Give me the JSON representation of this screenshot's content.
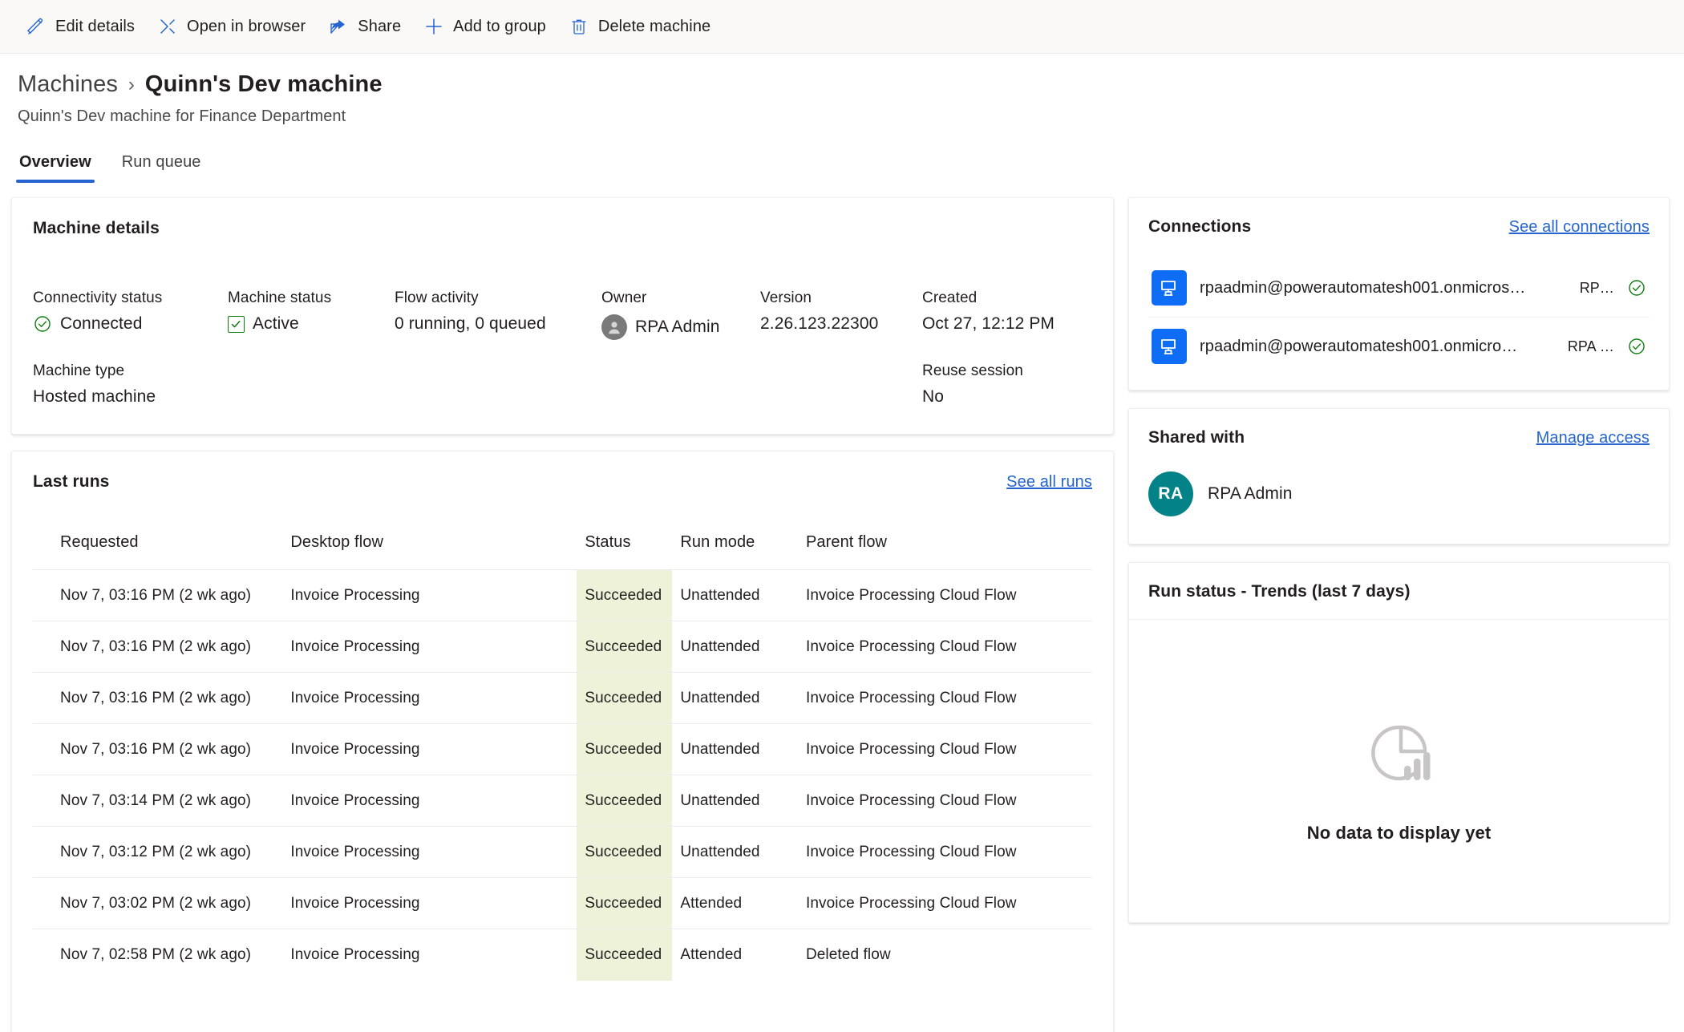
{
  "toolbar": {
    "items": [
      {
        "label": "Edit details",
        "icon": "pencil-icon"
      },
      {
        "label": "Open in browser",
        "icon": "open-in-browser-icon"
      },
      {
        "label": "Share",
        "icon": "share-icon"
      },
      {
        "label": "Add to group",
        "icon": "plus-icon"
      },
      {
        "label": "Delete machine",
        "icon": "trash-icon"
      }
    ]
  },
  "header": {
    "breadcrumb_parent": "Machines",
    "breadcrumb_separator": "›",
    "title": "Quinn's Dev machine",
    "subtitle": "Quinn's Dev machine for Finance Department"
  },
  "tabs": [
    {
      "label": "Overview",
      "active": true
    },
    {
      "label": "Run queue",
      "active": false
    }
  ],
  "machine_details": {
    "title": "Machine details",
    "fields": {
      "connectivity_status_label": "Connectivity status",
      "connectivity_status_value": "Connected",
      "machine_status_label": "Machine status",
      "machine_status_value": "Active",
      "flow_activity_label": "Flow activity",
      "flow_activity_value": "0 running, 0 queued",
      "owner_label": "Owner",
      "owner_value": "RPA Admin",
      "version_label": "Version",
      "version_value": "2.26.123.22300",
      "created_label": "Created",
      "created_value": "Oct 27, 12:12 PM",
      "machine_type_label": "Machine type",
      "machine_type_value": "Hosted machine",
      "reuse_session_label": "Reuse session",
      "reuse_session_value": "No"
    }
  },
  "last_runs": {
    "title": "Last runs",
    "see_all_label": "See all runs",
    "columns": [
      "Requested",
      "Desktop flow",
      "Status",
      "Run mode",
      "Parent flow"
    ],
    "rows": [
      {
        "requested": "Nov 7, 03:16 PM (2 wk ago)",
        "flow": "Invoice Processing",
        "status": "Succeeded",
        "mode": "Unattended",
        "parent": "Invoice Processing Cloud Flow",
        "parent_deleted": false
      },
      {
        "requested": "Nov 7, 03:16 PM (2 wk ago)",
        "flow": "Invoice Processing",
        "status": "Succeeded",
        "mode": "Unattended",
        "parent": "Invoice Processing Cloud Flow",
        "parent_deleted": false
      },
      {
        "requested": "Nov 7, 03:16 PM (2 wk ago)",
        "flow": "Invoice Processing",
        "status": "Succeeded",
        "mode": "Unattended",
        "parent": "Invoice Processing Cloud Flow",
        "parent_deleted": false
      },
      {
        "requested": "Nov 7, 03:16 PM (2 wk ago)",
        "flow": "Invoice Processing",
        "status": "Succeeded",
        "mode": "Unattended",
        "parent": "Invoice Processing Cloud Flow",
        "parent_deleted": false
      },
      {
        "requested": "Nov 7, 03:14 PM (2 wk ago)",
        "flow": "Invoice Processing",
        "status": "Succeeded",
        "mode": "Unattended",
        "parent": "Invoice Processing Cloud Flow",
        "parent_deleted": false
      },
      {
        "requested": "Nov 7, 03:12 PM (2 wk ago)",
        "flow": "Invoice Processing",
        "status": "Succeeded",
        "mode": "Unattended",
        "parent": "Invoice Processing Cloud Flow",
        "parent_deleted": false
      },
      {
        "requested": "Nov 7, 03:02 PM (2 wk ago)",
        "flow": "Invoice Processing",
        "status": "Succeeded",
        "mode": "Attended",
        "parent": "Invoice Processing Cloud Flow",
        "parent_deleted": false
      },
      {
        "requested": "Nov 7, 02:58 PM (2 wk ago)",
        "flow": "Invoice Processing",
        "status": "Succeeded",
        "mode": "Attended",
        "parent": "Deleted flow",
        "parent_deleted": true
      }
    ]
  },
  "connections": {
    "title": "Connections",
    "see_all_label": "See all connections",
    "rows": [
      {
        "name": "rpaadmin@powerautomatesh001.onmicros…",
        "owner": "RP…",
        "status": "connected"
      },
      {
        "name": "rpaadmin@powerautomatesh001.onmicro…",
        "owner": "RPA …",
        "status": "connected"
      }
    ]
  },
  "shared_with": {
    "title": "Shared with",
    "manage_label": "Manage access",
    "people": [
      {
        "initials": "RA",
        "name": "RPA Admin"
      }
    ]
  },
  "run_trends": {
    "title": "Run status - Trends (last 7 days)",
    "empty_text": "No data to display yet",
    "empty_icon": "chart-empty-icon"
  },
  "colors": {
    "accent": "#2564cf",
    "success_green": "#107c10",
    "status_cell_bg": "#eef2d8",
    "connection_blue": "#0f6cf5",
    "avatar_teal": "#038387",
    "command_bar_bg": "#faf9f8"
  }
}
